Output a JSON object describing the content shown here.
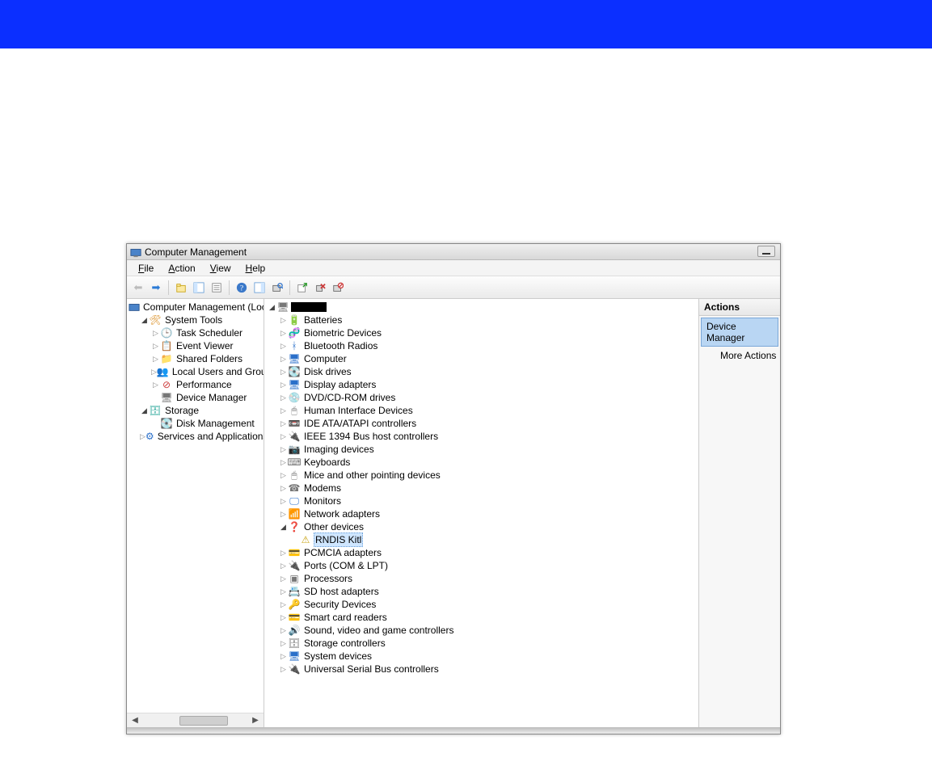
{
  "window": {
    "title": "Computer Management"
  },
  "menu": {
    "file": "File",
    "action": "Action",
    "view": "View",
    "help": "Help"
  },
  "left_tree": {
    "root": "Computer Management (Local",
    "system_tools": "System Tools",
    "task_scheduler": "Task Scheduler",
    "event_viewer": "Event Viewer",
    "shared_folders": "Shared Folders",
    "local_users": "Local Users and Groups",
    "performance": "Performance",
    "device_manager": "Device Manager",
    "storage": "Storage",
    "disk_management": "Disk Management",
    "services_apps": "Services and Applications"
  },
  "devices": {
    "batteries": "Batteries",
    "biometric": "Biometric Devices",
    "bluetooth": "Bluetooth Radios",
    "computer": "Computer",
    "disk_drives": "Disk drives",
    "display_adapters": "Display adapters",
    "dvd": "DVD/CD-ROM drives",
    "hid": "Human Interface Devices",
    "ide": "IDE ATA/ATAPI controllers",
    "ieee1394": "IEEE 1394 Bus host controllers",
    "imaging": "Imaging devices",
    "keyboards": "Keyboards",
    "mice": "Mice and other pointing devices",
    "modems": "Modems",
    "monitors": "Monitors",
    "network": "Network adapters",
    "other": "Other devices",
    "rndis": "RNDIS Kitl",
    "pcmcia": "PCMCIA adapters",
    "ports": "Ports (COM & LPT)",
    "processors": "Processors",
    "sdhost": "SD host adapters",
    "security": "Security Devices",
    "smartcard": "Smart card readers",
    "sound": "Sound, video and game controllers",
    "storage_ctrl": "Storage controllers",
    "system": "System devices",
    "usb": "Universal Serial Bus controllers"
  },
  "actions": {
    "header": "Actions",
    "device_manager": "Device Manager",
    "more_actions": "More Actions"
  }
}
